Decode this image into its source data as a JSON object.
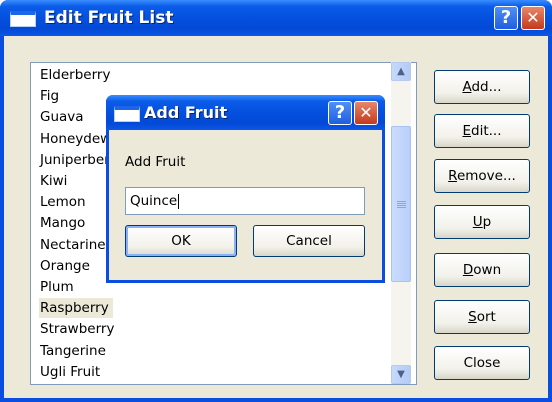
{
  "main_window": {
    "title": "Edit Fruit List",
    "help_glyph": "?",
    "close_glyph": "✕"
  },
  "fruit_list": {
    "items": [
      "Elderberry",
      "Fig",
      "Guava",
      "Honeydew",
      "Juniperberry",
      "Kiwi",
      "Lemon",
      "Mango",
      "Nectarine",
      "Orange",
      "Plum",
      "Raspberry",
      "Strawberry",
      "Tangerine",
      "Ugli Fruit"
    ],
    "selected": "Raspberry"
  },
  "scrollbar": {
    "up_glyph": "▲",
    "down_glyph": "▼",
    "position_fraction": 0.35,
    "thumb_fraction": 0.55
  },
  "buttons": {
    "add": {
      "before": "",
      "accel": "A",
      "after": "dd..."
    },
    "edit": {
      "before": "",
      "accel": "E",
      "after": "dit..."
    },
    "remove": {
      "before": "",
      "accel": "R",
      "after": "emove..."
    },
    "up": {
      "before": "",
      "accel": "U",
      "after": "p"
    },
    "down": {
      "before": "",
      "accel": "D",
      "after": "own"
    },
    "sort": {
      "before": "",
      "accel": "S",
      "after": "ort"
    },
    "close": {
      "label": "Close"
    }
  },
  "add_dialog": {
    "title": "Add Fruit",
    "help_glyph": "?",
    "close_glyph": "✕",
    "prompt_label": "Add Fruit",
    "input_value": "Quince",
    "ok_label": "OK",
    "cancel_label": "Cancel"
  },
  "icons": {
    "window_icon": "window-icon",
    "help_icon": "help-icon",
    "close_icon": "close-icon",
    "scroll_up_icon": "chevron-up-icon",
    "scroll_down_icon": "chevron-down-icon"
  },
  "colors": {
    "title_bar": "#0550df",
    "dialog_face": "#ece9d8",
    "button_border": "#003c74",
    "close_button": "#c43a1b"
  }
}
